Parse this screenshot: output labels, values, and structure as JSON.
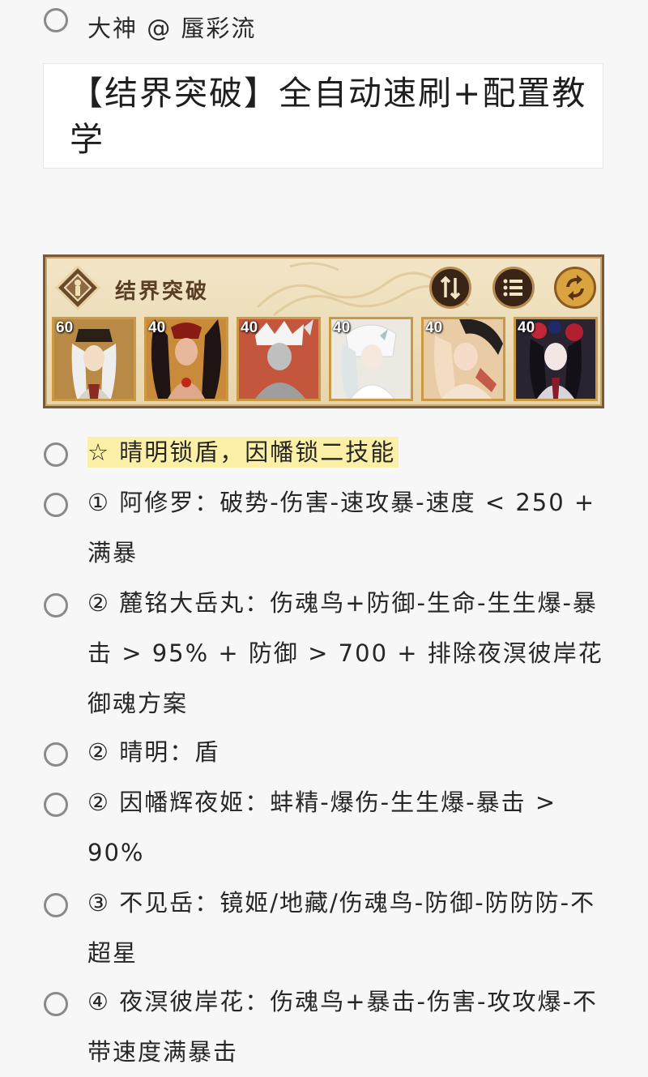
{
  "author": {
    "text": "大神 @ 蜃彩流"
  },
  "title_card": {
    "text": "【结界突破】全自动速刷+配置教学"
  },
  "banner": {
    "title": "结界突破",
    "buttons": [
      "sort-icon",
      "list-icon",
      "refresh-icon"
    ],
    "portraits": [
      {
        "level": "60",
        "bg": "#c9a15a"
      },
      {
        "level": "40",
        "bg": "#a33a2a"
      },
      {
        "level": "40",
        "bg": "#b5503a"
      },
      {
        "level": "40",
        "bg": "#e9e4de"
      },
      {
        "level": "40",
        "bg": "#e8c9a8"
      },
      {
        "level": "40",
        "bg": "#3a2a3a"
      }
    ]
  },
  "items": [
    {
      "text": "☆ 晴明锁盾，因幡锁二技能",
      "highlight": true
    },
    {
      "text": "① 阿修罗：破势-伤害-速攻暴-速度 < 250 + 满暴"
    },
    {
      "text": "② 麓铭大岳丸：伤魂鸟+防御-生命-生生爆-暴击 > 95% + 防御 > 700 + 排除夜溟彼岸花御魂方案"
    },
    {
      "text": "② 晴明：盾"
    },
    {
      "text": "② 因幡辉夜姬：蚌精-爆伤-生生爆-暴击 > 90%"
    },
    {
      "text": "③ 不见岳：镜姬/地藏/伤魂鸟-防御-防防防-不超星"
    },
    {
      "text": "④ 夜溟彼岸花：伤魂鸟+暴击-伤害-攻攻爆-不带速度满暴击"
    }
  ]
}
